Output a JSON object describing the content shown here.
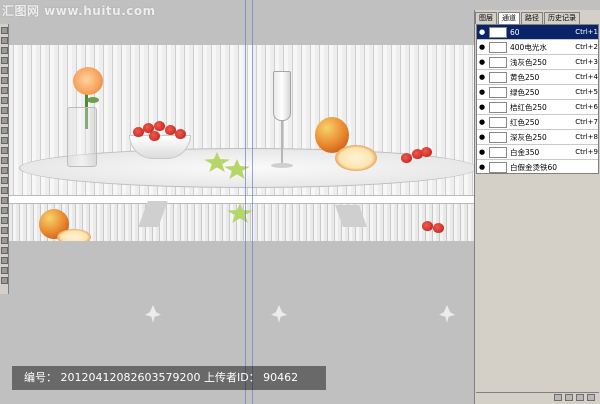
{
  "watermark": {
    "text": "汇图网 www.huitu.com"
  },
  "toolbox": {
    "tool_count": 26
  },
  "layers_panel": {
    "tabs": [
      {
        "label": "图层",
        "active": false
      },
      {
        "label": "通道",
        "active": true
      },
      {
        "label": "路径",
        "active": false
      },
      {
        "label": "历史记录",
        "active": false
      }
    ],
    "channels": [
      {
        "name": "60",
        "shortcut": "Ctrl+1",
        "selected": true
      },
      {
        "name": "400电光水",
        "shortcut": "Ctrl+2",
        "selected": false
      },
      {
        "name": "浅灰色250",
        "shortcut": "Ctrl+3",
        "selected": false
      },
      {
        "name": "黄色250",
        "shortcut": "Ctrl+4",
        "selected": false
      },
      {
        "name": "绿色250",
        "shortcut": "Ctrl+5",
        "selected": false
      },
      {
        "name": "桔红色250",
        "shortcut": "Ctrl+6",
        "selected": false
      },
      {
        "name": "红色250",
        "shortcut": "Ctrl+7",
        "selected": false
      },
      {
        "name": "深灰色250",
        "shortcut": "Ctrl+8",
        "selected": false
      },
      {
        "name": "白金350",
        "shortcut": "Ctrl+9",
        "selected": false
      },
      {
        "name": "白假金烫铁60",
        "shortcut": "",
        "selected": false
      }
    ]
  },
  "footer": {
    "text": "编号： 20120412082603579200 上传者ID： 90462"
  },
  "colors": {
    "selection": "#0a246a",
    "panel": "#d4d0c8",
    "canvas_bg": "#c0c0c0"
  }
}
